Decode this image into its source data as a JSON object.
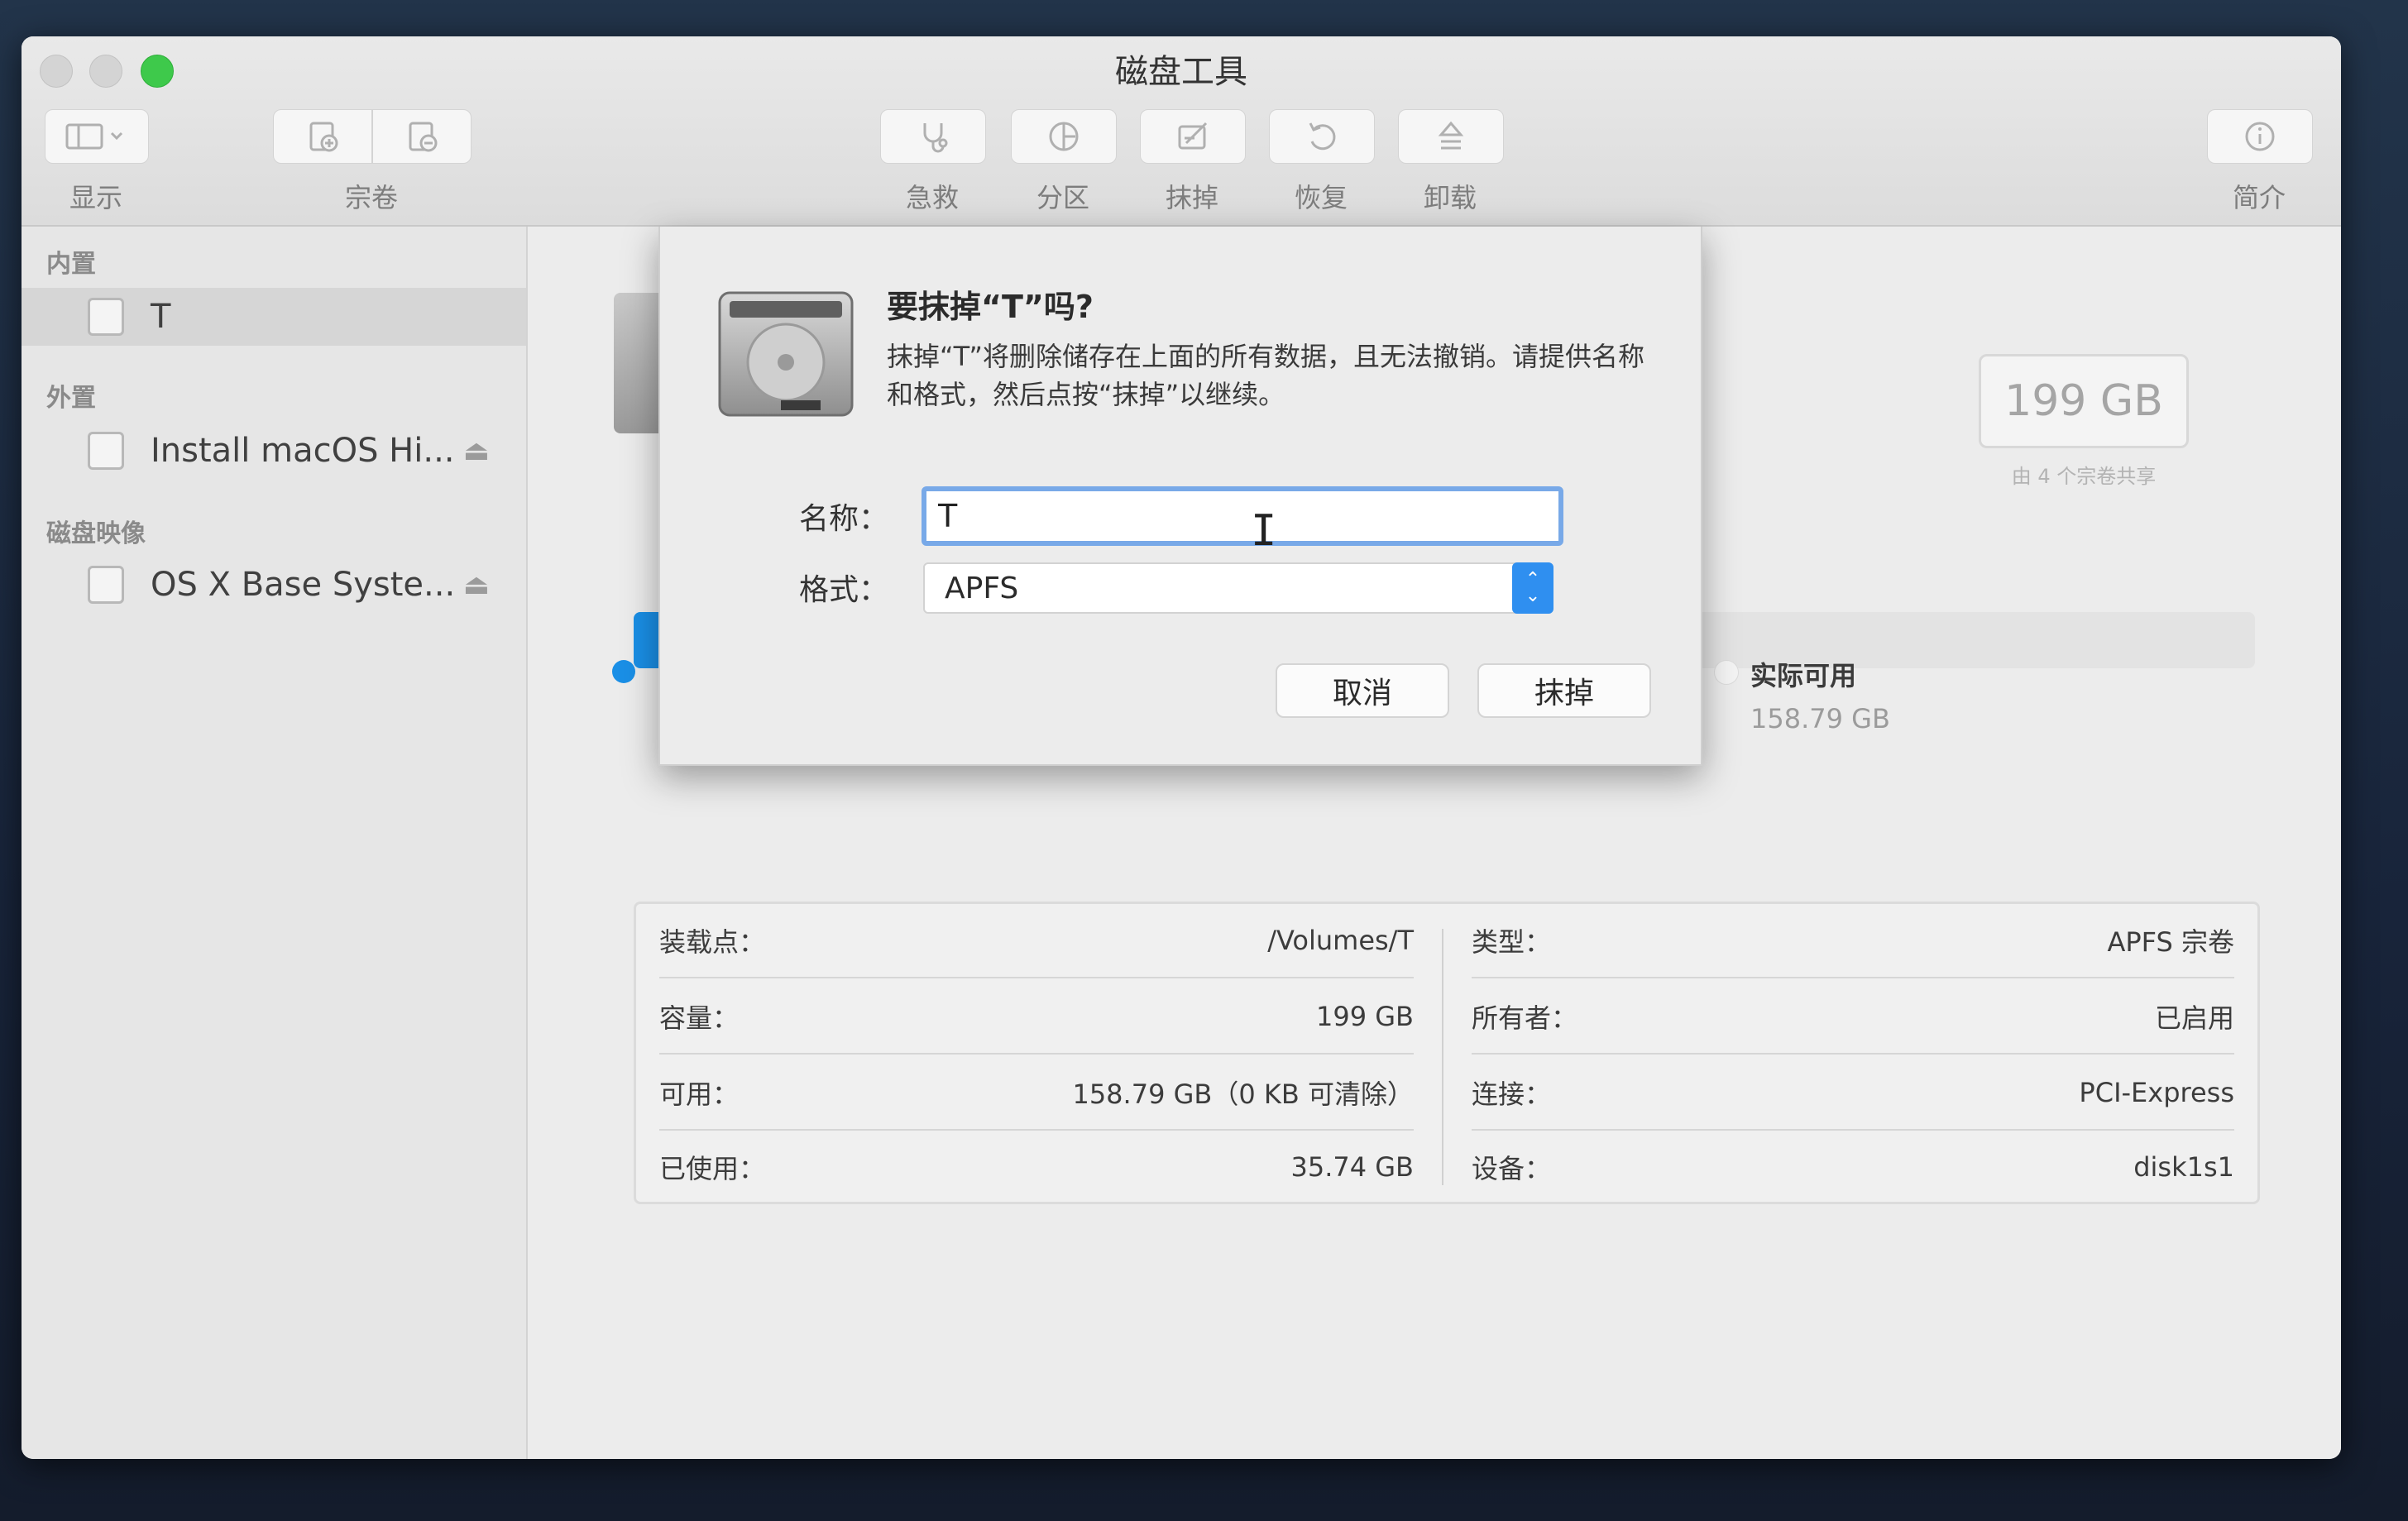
{
  "window": {
    "title": "磁盘工具"
  },
  "toolbar": {
    "display_label": "显示",
    "volume_label": "宗卷",
    "firstaid_label": "急救",
    "partition_label": "分区",
    "erase_label": "抹掉",
    "restore_label": "恢复",
    "unmount_label": "卸载",
    "info_label": "简介"
  },
  "sidebar": {
    "internal_header": "内置",
    "external_header": "外置",
    "images_header": "磁盘映像",
    "internal_items": [
      {
        "label": "T"
      }
    ],
    "external_items": [
      {
        "label": "Install macOS Hi..."
      }
    ],
    "image_items": [
      {
        "label": "OS X Base Syste..."
      }
    ]
  },
  "capacity": {
    "value": "199 GB",
    "shared_note": "由 4 个宗卷共享"
  },
  "usage": {
    "used_fraction": 0.18,
    "available_label": "实际可用",
    "available_value": "158.79 GB"
  },
  "info_left": [
    {
      "key": "装载点：",
      "value": "/Volumes/T"
    },
    {
      "key": "容量：",
      "value": "199 GB"
    },
    {
      "key": "可用：",
      "value": "158.79 GB（0 KB 可清除）"
    },
    {
      "key": "已使用：",
      "value": "35.74 GB"
    }
  ],
  "info_right": [
    {
      "key": "类型：",
      "value": "APFS 宗卷"
    },
    {
      "key": "所有者：",
      "value": "已启用"
    },
    {
      "key": "连接：",
      "value": "PCI-Express"
    },
    {
      "key": "设备：",
      "value": "disk1s1"
    }
  ],
  "dialog": {
    "title": "要抹掉“T”吗?",
    "message": "抹掉“T”将删除储存在上面的所有数据，且无法撤销。请提供名称和格式，然后点按“抹掉”以继续。",
    "name_label": "名称：",
    "name_value": "T",
    "format_label": "格式：",
    "format_value": "APFS",
    "cancel_label": "取消",
    "erase_label": "抹掉"
  },
  "colors": {
    "accent": "#2f8ff0",
    "focus_ring": "#78a9e8",
    "usage_fill": "#1a8fe6"
  }
}
